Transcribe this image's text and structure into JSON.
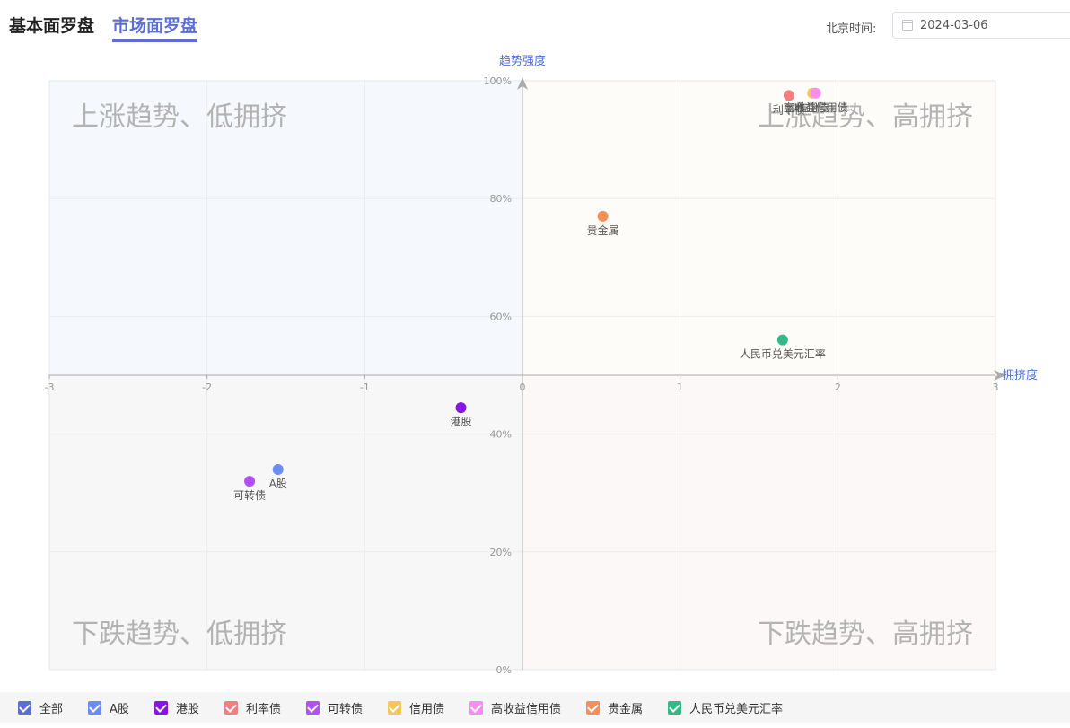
{
  "tabs": [
    {
      "label": "基本面罗盘",
      "active": false
    },
    {
      "label": "市场面罗盘",
      "active": true
    }
  ],
  "date_picker": {
    "label": "北京时间:",
    "value": "2024-03-06",
    "icon": "calendar-icon"
  },
  "chart_data": {
    "type": "scatter",
    "xlabel": "拥挤度",
    "ylabel": "趋势强度",
    "xlim": [
      -3,
      3
    ],
    "ylim": [
      0,
      100
    ],
    "xticks": [
      -3,
      -2,
      -1,
      0,
      1,
      2,
      3
    ],
    "yticks": [
      0,
      20,
      40,
      60,
      80,
      100
    ],
    "ytick_labels": [
      "0%",
      "20%",
      "40%",
      "60%",
      "80%",
      "100%"
    ],
    "grid": true,
    "quadrants": [
      {
        "label": "上涨趋势、低拥挤",
        "position": "top-left",
        "color": "#f5f9fe"
      },
      {
        "label": "上涨趋势、高拥挤",
        "position": "top-right",
        "color": "#fdfcf8"
      },
      {
        "label": "下跌趋势、低拥挤",
        "position": "bottom-left",
        "color": "#f7f7f7"
      },
      {
        "label": "下跌趋势、高拥挤",
        "position": "bottom-right",
        "color": "#fcf8f7"
      }
    ],
    "points": [
      {
        "name": "A股",
        "x": -1.55,
        "y": 34,
        "color": "#6b8cf2"
      },
      {
        "name": "港股",
        "x": -0.39,
        "y": 44.5,
        "color": "#8a14e0"
      },
      {
        "name": "利率债",
        "x": 1.69,
        "y": 97.5,
        "color": "#f08080"
      },
      {
        "name": "可转债",
        "x": -1.73,
        "y": 32,
        "color": "#b44ff0"
      },
      {
        "name": "信用债",
        "x": 1.84,
        "y": 97.9,
        "color": "#f3c75a"
      },
      {
        "name": "高收益信用债",
        "x": 1.86,
        "y": 97.9,
        "color": "#f58ef0"
      },
      {
        "name": "贵金属",
        "x": 0.51,
        "y": 77,
        "color": "#f39058"
      },
      {
        "name": "人民币兑美元汇率",
        "x": 1.65,
        "y": 56,
        "color": "#2fbb88"
      }
    ]
  },
  "legend": [
    {
      "label": "全部",
      "color": "#5b6dd6"
    },
    {
      "label": "A股",
      "color": "#6b8cf2"
    },
    {
      "label": "港股",
      "color": "#8a14e0"
    },
    {
      "label": "利率债",
      "color": "#f08080"
    },
    {
      "label": "可转债",
      "color": "#b44ff0"
    },
    {
      "label": "信用债",
      "color": "#f3c75a"
    },
    {
      "label": "高收益信用债",
      "color": "#f58ef0"
    },
    {
      "label": "贵金属",
      "color": "#f39058"
    },
    {
      "label": "人民币兑美元汇率",
      "color": "#2fbb88"
    }
  ]
}
